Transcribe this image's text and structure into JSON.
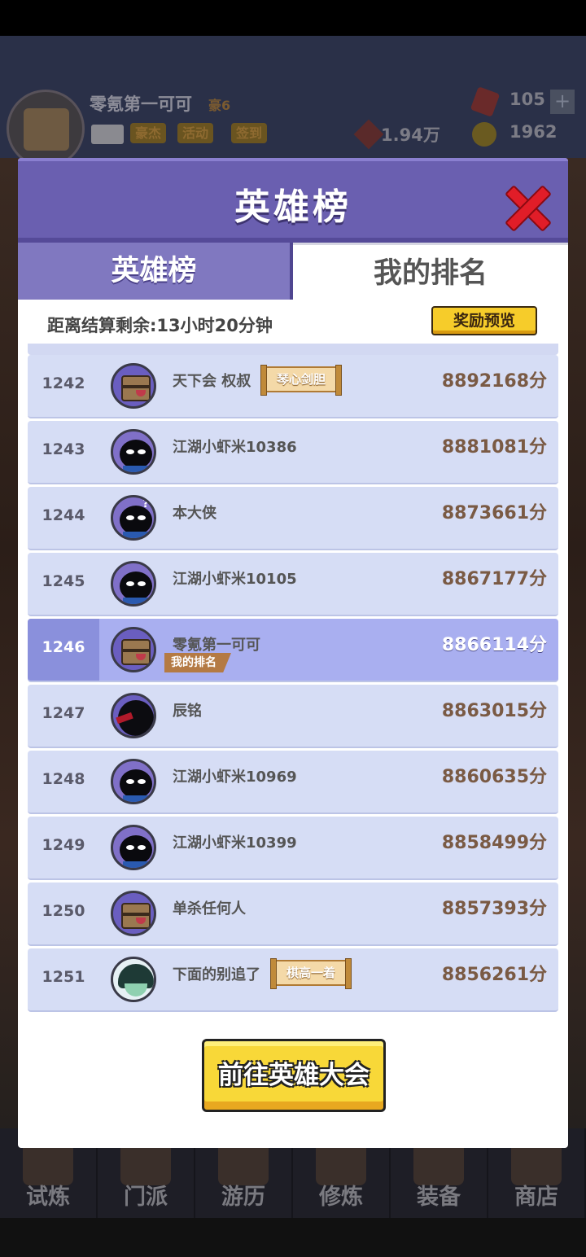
{
  "background": {
    "player_name": "零氪第一可可",
    "vip_label": "豪6",
    "chips": [
      "豪杰",
      "活动",
      "签到"
    ],
    "power": "1.94万",
    "gems": "105",
    "coins": "1962",
    "plus": "+",
    "nav": [
      "试炼",
      "门派",
      "游历",
      "修炼",
      "装备",
      "商店"
    ]
  },
  "dialog": {
    "title": "英雄榜",
    "tabs": [
      "英雄榜",
      "我的排名"
    ],
    "active_tab": "我的排名",
    "timer": "距离结算剩余:13小时20分钟",
    "reward_button": "奖励预览",
    "my_rank_badge": "我的排名",
    "go_button": "前往英雄大会"
  },
  "ranking": [
    {
      "rank": "1242",
      "name": "天下会 权叔",
      "score": "8892168分",
      "title": "琴心剑胆",
      "avatar": "chest-avatar"
    },
    {
      "rank": "1243",
      "name": "江湖小虾米10386",
      "score": "8881081分",
      "title": "",
      "avatar": "shadow-ninja-avatar"
    },
    {
      "rank": "1244",
      "name": "本大侠",
      "score": "8873661分",
      "title": "",
      "avatar": "confused-ninja-avatar"
    },
    {
      "rank": "1245",
      "name": "江湖小虾米10105",
      "score": "8867177分",
      "title": "",
      "avatar": "shadow-ninja-avatar"
    },
    {
      "rank": "1246",
      "name": "零氪第一可可",
      "score": "8866114分",
      "title": "",
      "avatar": "chest-avatar",
      "is_me": true
    },
    {
      "rank": "1247",
      "name": "辰铭",
      "score": "8863015分",
      "title": "",
      "avatar": "dark-ninja-avatar"
    },
    {
      "rank": "1248",
      "name": "江湖小虾米10969",
      "score": "8860635分",
      "title": "",
      "avatar": "shadow-ninja-avatar"
    },
    {
      "rank": "1249",
      "name": "江湖小虾米10399",
      "score": "8858499分",
      "title": "",
      "avatar": "shadow-ninja-avatar"
    },
    {
      "rank": "1250",
      "name": "单杀任何人",
      "score": "8857393分",
      "title": "",
      "avatar": "chest-avatar"
    },
    {
      "rank": "1251",
      "name": "下面的别追了",
      "score": "8856261分",
      "title": "棋高一着",
      "avatar": "monk-avatar"
    }
  ],
  "colors": {
    "header": "#6a5fb0",
    "row": "#d6ddf5",
    "my_row": "#a9aff0",
    "score": "#7a5a44",
    "close": "#e11d28",
    "button": "#f8d838"
  }
}
